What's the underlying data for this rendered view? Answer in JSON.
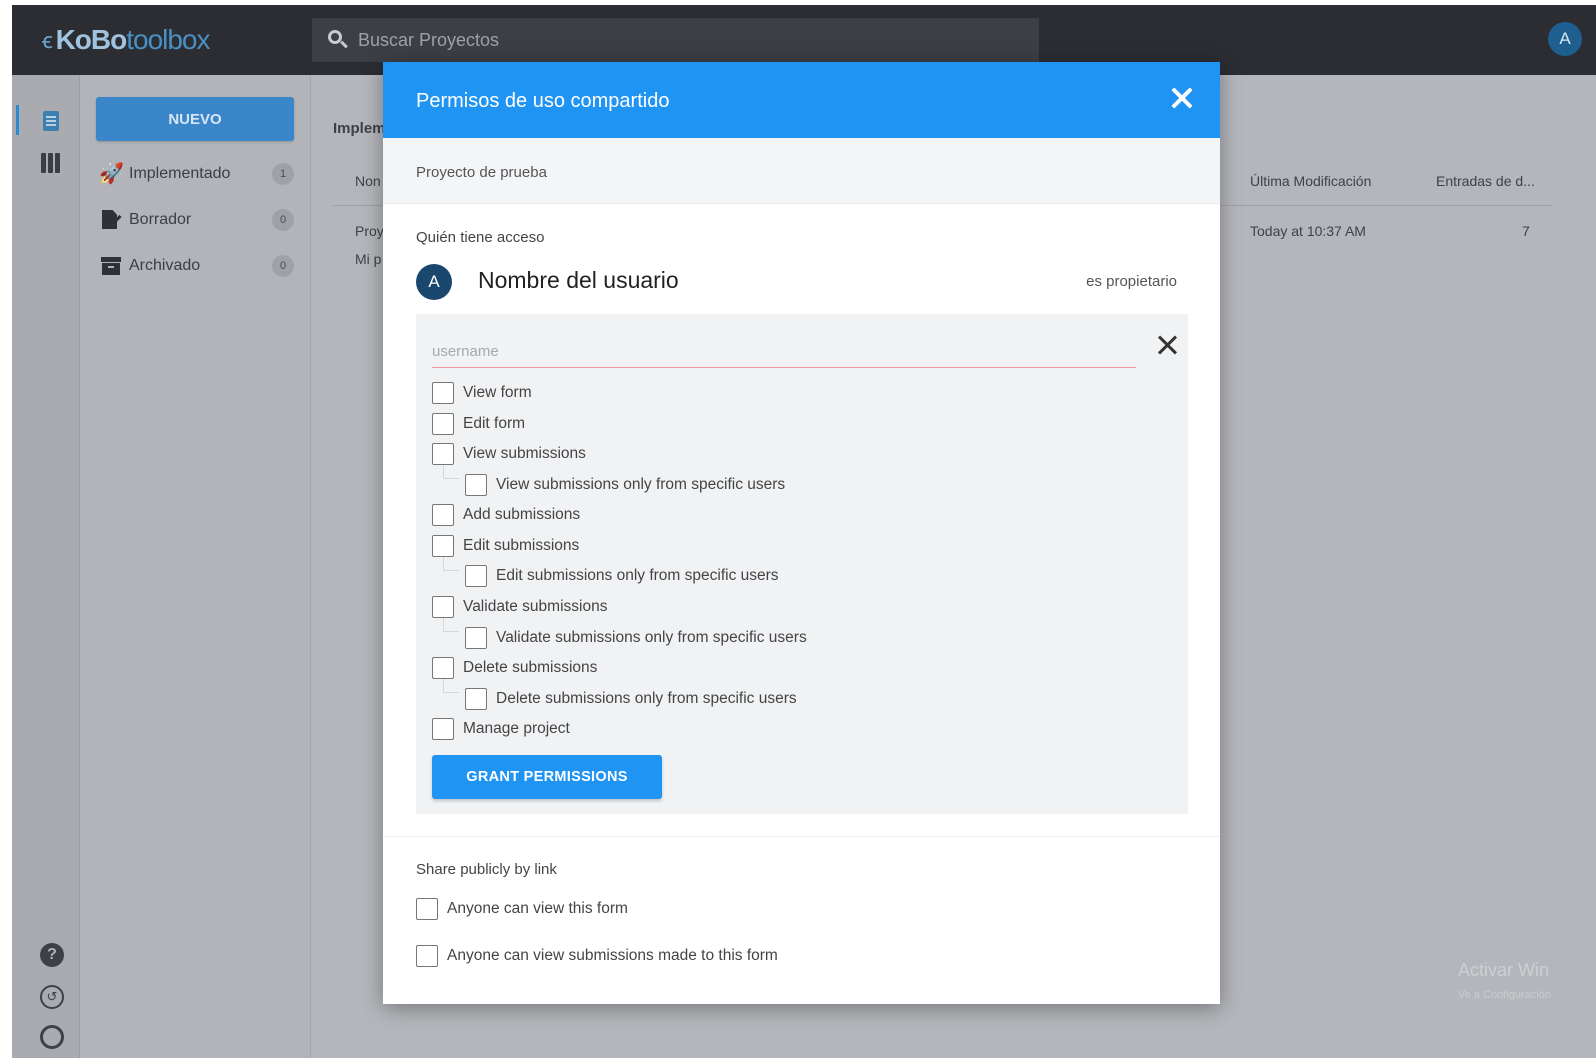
{
  "header": {
    "logo_kobo": "KoBo",
    "logo_toolbox": "toolbox",
    "search_placeholder": "Buscar Proyectos",
    "user_initial": "A"
  },
  "sidebar": {
    "new_button": "NUEVO",
    "items": [
      {
        "label": "Implementado",
        "count": "1",
        "icon": "rocket-icon"
      },
      {
        "label": "Borrador",
        "count": "0",
        "icon": "draft-icon"
      },
      {
        "label": "Archivado",
        "count": "0",
        "icon": "archive-icon"
      }
    ]
  },
  "background_list": {
    "section": "Implem",
    "col_name": "Non",
    "row1": "Proy",
    "row2": "Mi p",
    "col_modified": "Última Modificación",
    "col_entries": "Entradas de d...",
    "modified_value": "Today at 10:37 AM",
    "entries_value": "7"
  },
  "modal": {
    "title": "Permisos de uso compartido",
    "project_name": "Proyecto de prueba",
    "who_has_access": "Quién tiene acceso",
    "owner": {
      "initial": "A",
      "name": "Nombre del usuario",
      "role": "es propietario"
    },
    "username_placeholder": "username",
    "permissions": [
      {
        "label": "View form",
        "level": 0,
        "checked": false
      },
      {
        "label": "Edit form",
        "level": 0,
        "checked": false
      },
      {
        "label": "View submissions",
        "level": 0,
        "checked": false
      },
      {
        "label": "View submissions only from specific users",
        "level": 1,
        "checked": false
      },
      {
        "label": "Add submissions",
        "level": 0,
        "checked": false
      },
      {
        "label": "Edit submissions",
        "level": 0,
        "checked": false
      },
      {
        "label": "Edit submissions only from specific users",
        "level": 1,
        "checked": false
      },
      {
        "label": "Validate submissions",
        "level": 0,
        "checked": false
      },
      {
        "label": "Validate submissions only from specific users",
        "level": 1,
        "checked": false
      },
      {
        "label": "Delete submissions",
        "level": 0,
        "checked": false
      },
      {
        "label": "Delete submissions only from specific users",
        "level": 1,
        "checked": false
      },
      {
        "label": "Manage project",
        "level": 0,
        "checked": false
      }
    ],
    "grant_button": "GRANT PERMISSIONS",
    "public_section": "Share publicly by link",
    "public_options": [
      {
        "label": "Anyone can view this form",
        "checked": false
      },
      {
        "label": "Anyone can view submissions made to this form",
        "checked": false
      }
    ]
  },
  "colors": {
    "primary": "#2094f3",
    "topbar": "#2b2d33",
    "overlay_bg": "#b4b6bb",
    "owner_avatar": "#19476e"
  }
}
